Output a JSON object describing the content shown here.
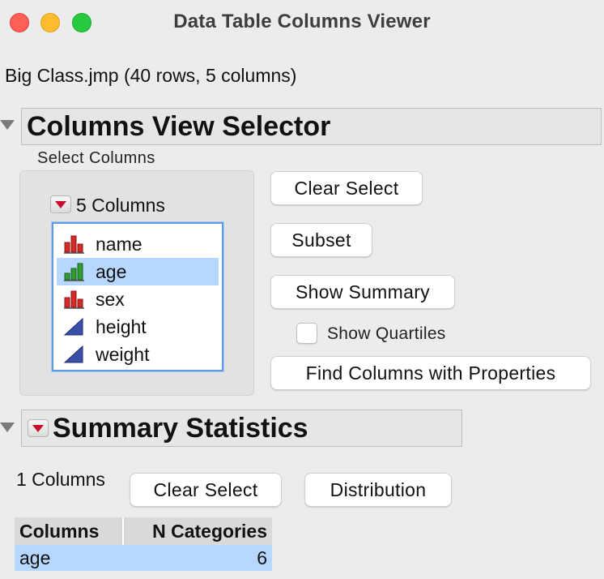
{
  "window": {
    "title": "Data Table Columns Viewer"
  },
  "file_info": "Big Class.jmp (40 rows, 5 columns)",
  "columns_view_selector": {
    "header": "Columns View Selector",
    "select_label": "Select Columns",
    "count_label": "5 Columns",
    "columns": [
      {
        "name": "name",
        "icon": "nominal-bar-icon",
        "selected": false
      },
      {
        "name": "age",
        "icon": "ordinal-bar-icon",
        "selected": true
      },
      {
        "name": "sex",
        "icon": "nominal-bar-icon",
        "selected": false
      },
      {
        "name": "height",
        "icon": "continuous-triangle-icon",
        "selected": false
      },
      {
        "name": "weight",
        "icon": "continuous-triangle-icon",
        "selected": false
      }
    ],
    "buttons": {
      "clear_select": "Clear Select",
      "subset": "Subset",
      "show_summary": "Show Summary",
      "find_columns": "Find Columns with Properties"
    },
    "show_quartiles": {
      "label": "Show Quartiles",
      "checked": false
    }
  },
  "summary_statistics": {
    "header": "Summary Statistics",
    "count_label": "1 Columns",
    "buttons": {
      "clear_select": "Clear Select",
      "distribution": "Distribution"
    },
    "table": {
      "headers": [
        "Columns",
        "N Categories"
      ],
      "rows": [
        [
          "age",
          "6"
        ]
      ]
    }
  },
  "colors": {
    "nominal": "#d42a2a",
    "ordinal": "#2f9e2f",
    "continuous": "#3a4fa8",
    "selection": "#b6d7ff",
    "focus_ring": "#5d9be4"
  }
}
